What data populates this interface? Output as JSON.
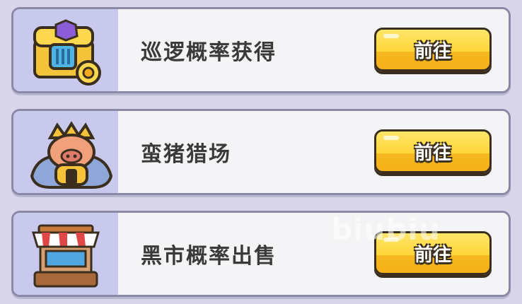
{
  "items": [
    {
      "icon": "treasure-chest-icon",
      "title": "巡逻概率获得",
      "button_label": "前往"
    },
    {
      "icon": "barbarian-pig-helmet-icon",
      "title": "蛮猪猎场",
      "button_label": "前往"
    },
    {
      "icon": "market-stall-icon",
      "title": "黑市概率出售",
      "button_label": "前往"
    }
  ],
  "watermark": "biubiu",
  "colors": {
    "card_bg": "#f4f4f6",
    "thumb_bg": "#c9c9ee",
    "button_yellow": "#ffd63a",
    "page_bg": "#d9d6ec"
  }
}
